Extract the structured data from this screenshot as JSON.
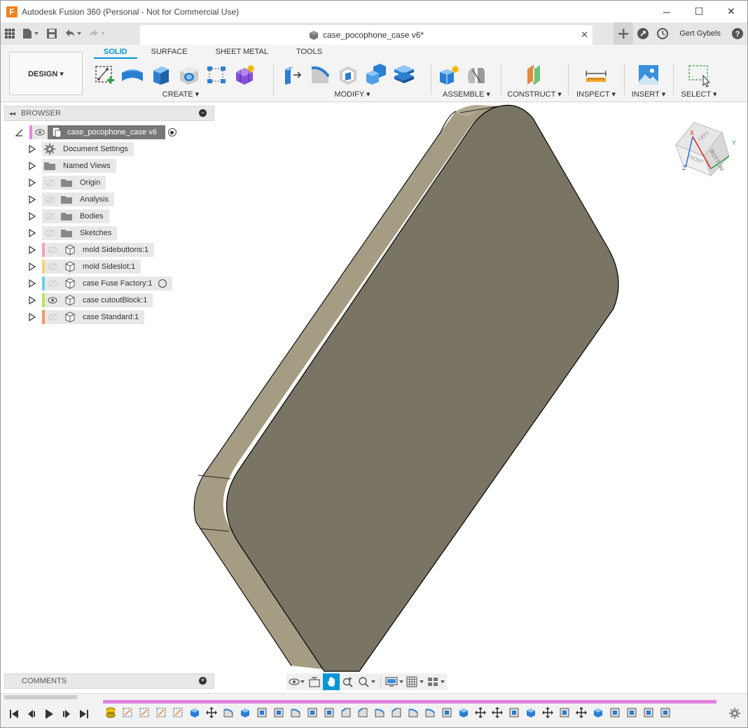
{
  "window": {
    "logo_letter": "F",
    "title": "Autodesk Fusion 360 (Personal - Not for Commercial Use)",
    "minimize": "─",
    "maximize": "☐",
    "close": "✕"
  },
  "document_tab": {
    "title": "case_pocophone_case v6*",
    "close": "✕"
  },
  "user": {
    "name": "Gert Gybels"
  },
  "workspace": {
    "label": "DESIGN ▾"
  },
  "ribbon_tabs": [
    {
      "label": "SOLID",
      "active": true
    },
    {
      "label": "SURFACE",
      "active": false
    },
    {
      "label": "SHEET METAL",
      "active": false
    },
    {
      "label": "TOOLS",
      "active": false
    }
  ],
  "ribbon_groups": {
    "create": "CREATE ▾",
    "modify": "MODIFY ▾",
    "assemble": "ASSEMBLE ▾",
    "construct": "CONSTRUCT ▾",
    "inspect": "INSPECT ▾",
    "insert": "INSERT ▾",
    "select": "SELECT ▾"
  },
  "browser": {
    "title": "BROWSER",
    "collapse": "◂◂",
    "minus": "−",
    "root": "case_pocophone_case v6",
    "items": [
      {
        "label": "Document Settings",
        "icon": "gear-icon"
      },
      {
        "label": "Named Views",
        "icon": "folder-icon"
      },
      {
        "label": "Origin",
        "icon": "folder-icon"
      },
      {
        "label": "Analysis",
        "icon": "folder-icon"
      },
      {
        "label": "Bodies",
        "icon": "folder-icon"
      },
      {
        "label": "Sketches",
        "icon": "folder-icon"
      },
      {
        "label": "mold Sidebuttons:1",
        "icon": "component-icon",
        "color": "#f4a0b8"
      },
      {
        "label": "mold Sideslot:1",
        "icon": "component-icon",
        "color": "#f6d46a"
      },
      {
        "label": "case Fuse Factory:1",
        "icon": "component-icon",
        "color": "#6ad3e6"
      },
      {
        "label": "case cutoutBlock:1",
        "icon": "component-icon",
        "color": "#bde35a"
      },
      {
        "label": "case Standard:1",
        "icon": "component-icon",
        "color": "#f29a5e"
      }
    ]
  },
  "comments": {
    "title": "COMMENTS",
    "plus": "+"
  },
  "viewcube": {
    "face_top": "LEFT",
    "face_front": "BOTTOM",
    "face_right": "FRONT",
    "axis_x": "X",
    "axis_y": "Y",
    "axis_z": "Z"
  },
  "colors": {
    "accent": "#0696d7",
    "body_face": "#7a7464",
    "body_side": "#a59c84",
    "timeline_bar": "#e280e2"
  }
}
